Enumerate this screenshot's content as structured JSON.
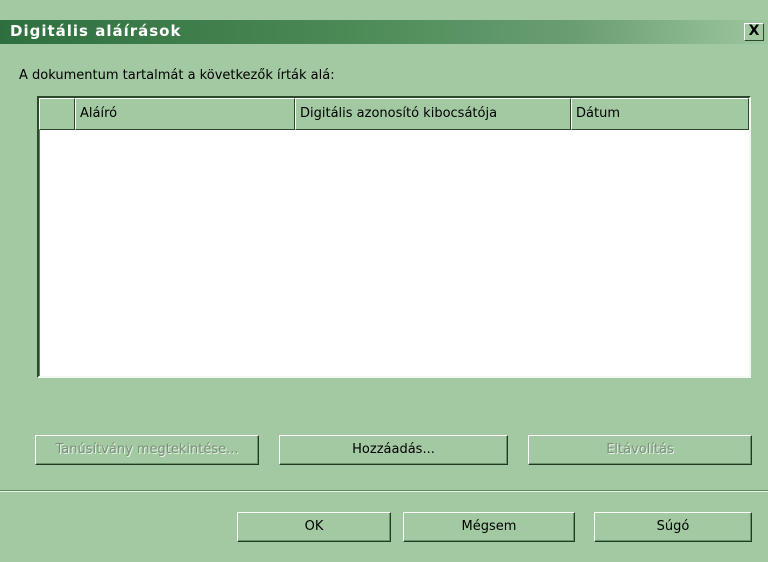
{
  "window": {
    "title": "Digitális aláírások",
    "close_label": "X"
  },
  "intro_label": "A dokumentum tartalmát a következők írták alá:",
  "list": {
    "columns": [
      "",
      "Aláíró",
      "Digitális azonosító kibocsátója",
      "Dátum"
    ],
    "rows": []
  },
  "buttons": {
    "view_cert": {
      "label": "Tanúsítvány megtekintése...",
      "enabled": false
    },
    "add": {
      "label": "Hozzáadás...",
      "enabled": true
    },
    "remove": {
      "label": "Eltávolítás",
      "enabled": false
    },
    "ok": {
      "label": "OK"
    },
    "cancel": {
      "label": "Mégsem"
    },
    "help": {
      "label": "Súgó"
    }
  }
}
